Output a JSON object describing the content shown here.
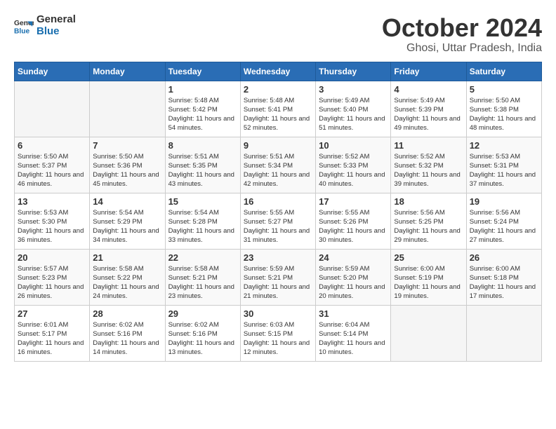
{
  "logo": {
    "text_general": "General",
    "text_blue": "Blue"
  },
  "title": "October 2024",
  "subtitle": "Ghosi, Uttar Pradesh, India",
  "days_of_week": [
    "Sunday",
    "Monday",
    "Tuesday",
    "Wednesday",
    "Thursday",
    "Friday",
    "Saturday"
  ],
  "weeks": [
    [
      {
        "day": "",
        "info": ""
      },
      {
        "day": "",
        "info": ""
      },
      {
        "day": "1",
        "info": "Sunrise: 5:48 AM\nSunset: 5:42 PM\nDaylight: 11 hours and 54 minutes."
      },
      {
        "day": "2",
        "info": "Sunrise: 5:48 AM\nSunset: 5:41 PM\nDaylight: 11 hours and 52 minutes."
      },
      {
        "day": "3",
        "info": "Sunrise: 5:49 AM\nSunset: 5:40 PM\nDaylight: 11 hours and 51 minutes."
      },
      {
        "day": "4",
        "info": "Sunrise: 5:49 AM\nSunset: 5:39 PM\nDaylight: 11 hours and 49 minutes."
      },
      {
        "day": "5",
        "info": "Sunrise: 5:50 AM\nSunset: 5:38 PM\nDaylight: 11 hours and 48 minutes."
      }
    ],
    [
      {
        "day": "6",
        "info": "Sunrise: 5:50 AM\nSunset: 5:37 PM\nDaylight: 11 hours and 46 minutes."
      },
      {
        "day": "7",
        "info": "Sunrise: 5:50 AM\nSunset: 5:36 PM\nDaylight: 11 hours and 45 minutes."
      },
      {
        "day": "8",
        "info": "Sunrise: 5:51 AM\nSunset: 5:35 PM\nDaylight: 11 hours and 43 minutes."
      },
      {
        "day": "9",
        "info": "Sunrise: 5:51 AM\nSunset: 5:34 PM\nDaylight: 11 hours and 42 minutes."
      },
      {
        "day": "10",
        "info": "Sunrise: 5:52 AM\nSunset: 5:33 PM\nDaylight: 11 hours and 40 minutes."
      },
      {
        "day": "11",
        "info": "Sunrise: 5:52 AM\nSunset: 5:32 PM\nDaylight: 11 hours and 39 minutes."
      },
      {
        "day": "12",
        "info": "Sunrise: 5:53 AM\nSunset: 5:31 PM\nDaylight: 11 hours and 37 minutes."
      }
    ],
    [
      {
        "day": "13",
        "info": "Sunrise: 5:53 AM\nSunset: 5:30 PM\nDaylight: 11 hours and 36 minutes."
      },
      {
        "day": "14",
        "info": "Sunrise: 5:54 AM\nSunset: 5:29 PM\nDaylight: 11 hours and 34 minutes."
      },
      {
        "day": "15",
        "info": "Sunrise: 5:54 AM\nSunset: 5:28 PM\nDaylight: 11 hours and 33 minutes."
      },
      {
        "day": "16",
        "info": "Sunrise: 5:55 AM\nSunset: 5:27 PM\nDaylight: 11 hours and 31 minutes."
      },
      {
        "day": "17",
        "info": "Sunrise: 5:55 AM\nSunset: 5:26 PM\nDaylight: 11 hours and 30 minutes."
      },
      {
        "day": "18",
        "info": "Sunrise: 5:56 AM\nSunset: 5:25 PM\nDaylight: 11 hours and 29 minutes."
      },
      {
        "day": "19",
        "info": "Sunrise: 5:56 AM\nSunset: 5:24 PM\nDaylight: 11 hours and 27 minutes."
      }
    ],
    [
      {
        "day": "20",
        "info": "Sunrise: 5:57 AM\nSunset: 5:23 PM\nDaylight: 11 hours and 26 minutes."
      },
      {
        "day": "21",
        "info": "Sunrise: 5:58 AM\nSunset: 5:22 PM\nDaylight: 11 hours and 24 minutes."
      },
      {
        "day": "22",
        "info": "Sunrise: 5:58 AM\nSunset: 5:21 PM\nDaylight: 11 hours and 23 minutes."
      },
      {
        "day": "23",
        "info": "Sunrise: 5:59 AM\nSunset: 5:21 PM\nDaylight: 11 hours and 21 minutes."
      },
      {
        "day": "24",
        "info": "Sunrise: 5:59 AM\nSunset: 5:20 PM\nDaylight: 11 hours and 20 minutes."
      },
      {
        "day": "25",
        "info": "Sunrise: 6:00 AM\nSunset: 5:19 PM\nDaylight: 11 hours and 19 minutes."
      },
      {
        "day": "26",
        "info": "Sunrise: 6:00 AM\nSunset: 5:18 PM\nDaylight: 11 hours and 17 minutes."
      }
    ],
    [
      {
        "day": "27",
        "info": "Sunrise: 6:01 AM\nSunset: 5:17 PM\nDaylight: 11 hours and 16 minutes."
      },
      {
        "day": "28",
        "info": "Sunrise: 6:02 AM\nSunset: 5:16 PM\nDaylight: 11 hours and 14 minutes."
      },
      {
        "day": "29",
        "info": "Sunrise: 6:02 AM\nSunset: 5:16 PM\nDaylight: 11 hours and 13 minutes."
      },
      {
        "day": "30",
        "info": "Sunrise: 6:03 AM\nSunset: 5:15 PM\nDaylight: 11 hours and 12 minutes."
      },
      {
        "day": "31",
        "info": "Sunrise: 6:04 AM\nSunset: 5:14 PM\nDaylight: 11 hours and 10 minutes."
      },
      {
        "day": "",
        "info": ""
      },
      {
        "day": "",
        "info": ""
      }
    ]
  ]
}
